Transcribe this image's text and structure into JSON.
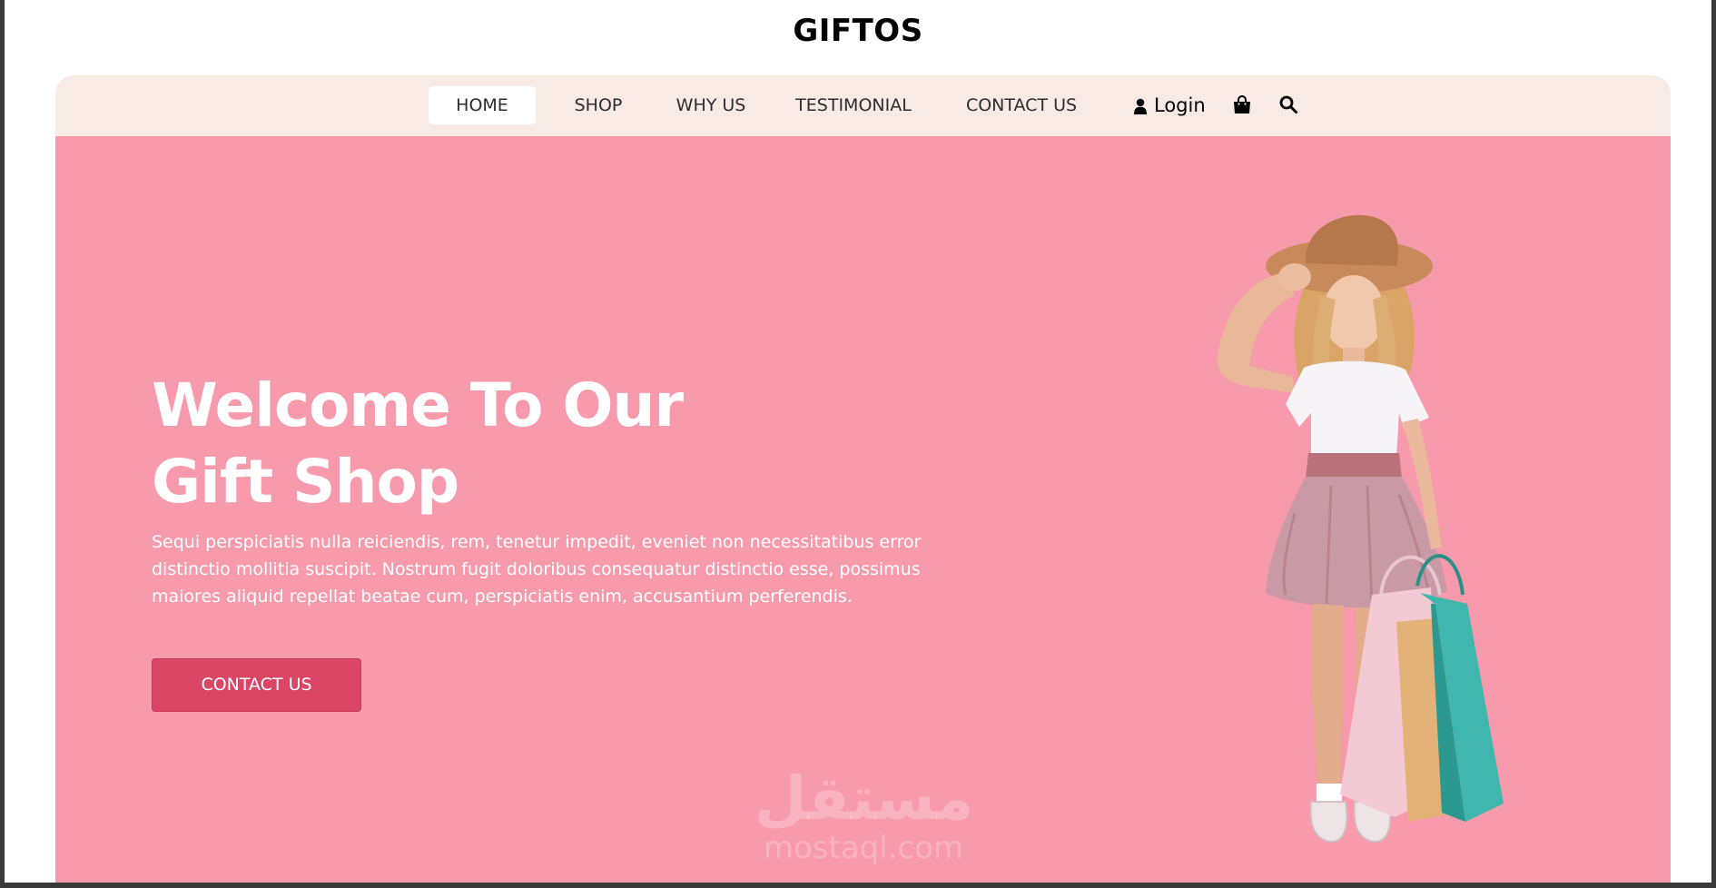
{
  "brand": {
    "name": "GIFTOS"
  },
  "nav": {
    "items": [
      {
        "label": "HOME",
        "active": true
      },
      {
        "label": "SHOP"
      },
      {
        "label": "WHY US"
      },
      {
        "label": "TESTIMONIAL"
      },
      {
        "label": "CONTACT US"
      }
    ],
    "login_label": "Login",
    "icons": [
      "user-icon",
      "shopping-bag-icon",
      "search-icon"
    ]
  },
  "hero": {
    "title_line1": "Welcome To Our",
    "title_line2": "Gift Shop",
    "description": "Sequi perspiciatis nulla reiciendis, rem, tenetur impedit, eveniet non necessitatibus error distinctio mollitia suscipit. Nostrum fugit doloribus consequatur distinctio esse, possimus maiores aliquid repellat beatae cum, perspiciatis enim, accusantium perferendis.",
    "cta_label": "CONTACT US"
  },
  "watermark": {
    "arabic": "مستقل",
    "latin": "mostaql.com"
  },
  "colors": {
    "hero_bg": "#f79aab",
    "nav_bg": "#f8eae4",
    "cta_bg": "#db4566"
  }
}
